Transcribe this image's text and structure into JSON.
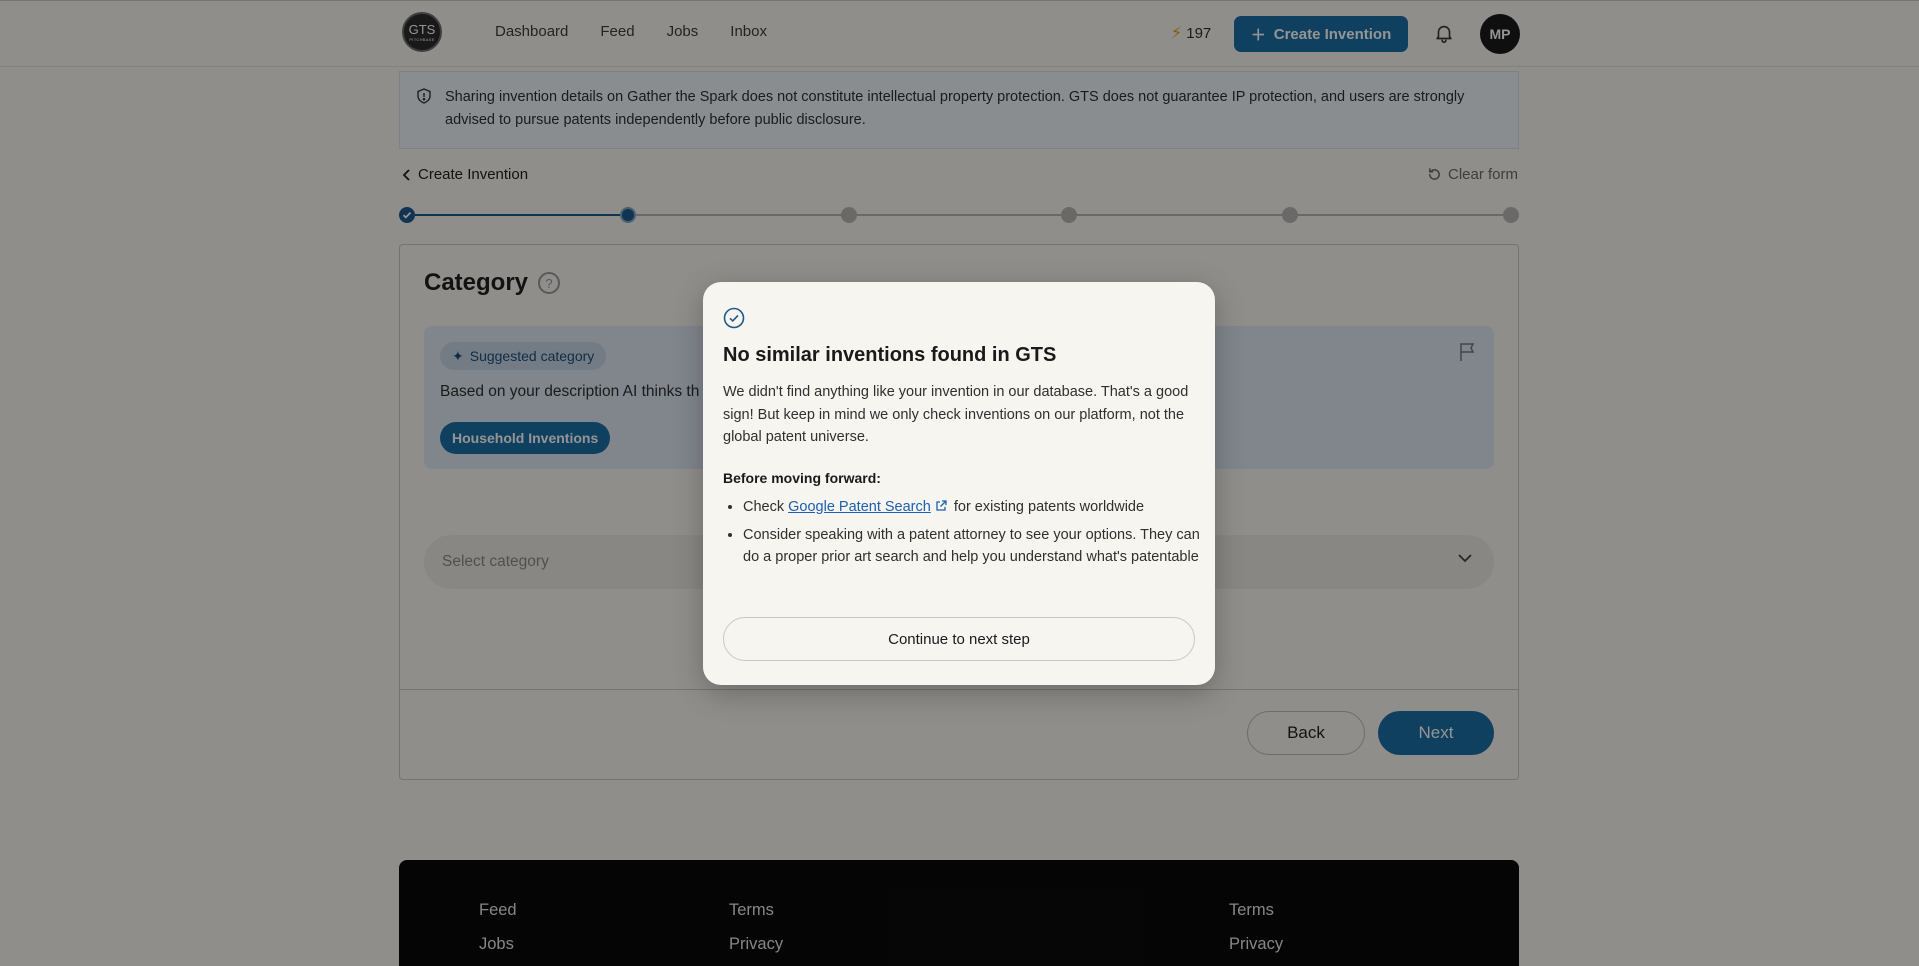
{
  "header": {
    "logo_text": "GTS",
    "logo_subtext": "PITCHBASE",
    "nav": [
      "Dashboard",
      "Feed",
      "Jobs",
      "Inbox"
    ],
    "credits": "197",
    "create_button": "Create Invention",
    "avatar_initials": "MP"
  },
  "notice": {
    "text": "Sharing invention details on Gather the Spark does not constitute intellectual property protection. GTS does not guarantee IP protection, and users are strongly advised to pursue patents independently before public disclosure."
  },
  "page": {
    "back_label": "Create Invention",
    "clear_form": "Clear form",
    "stepper": {
      "total_steps": 6,
      "completed": 1,
      "current": 2
    }
  },
  "card": {
    "title": "Category",
    "suggest_chip": "Suggested category",
    "suggest_text": "Based on your description AI thinks th",
    "suggested_value": "Household Inventions",
    "select_placeholder": "Select category",
    "back_button": "Back",
    "next_button": "Next"
  },
  "footer": {
    "col1": [
      "Feed",
      "Jobs"
    ],
    "col2": [
      "Terms",
      "Privacy"
    ],
    "col3": [
      "Terms",
      "Privacy"
    ]
  },
  "modal": {
    "title": "No similar inventions found in GTS",
    "description": "We didn't find anything like your invention in our database. That's a good sign! But keep in mind we only check inventions on our platform, not the global patent universe.",
    "before_heading": "Before moving forward:",
    "bullet1_prefix": "Check",
    "bullet1_link": "Google Patent Search",
    "bullet1_suffix": "for existing patents worldwide",
    "bullet2": "Consider speaking with a patent attorney to see your options. They can do a proper prior art search and help you understand what's patentable",
    "continue_button": "Continue to next step"
  },
  "colors": {
    "accent": "#1c6ea4",
    "link": "#1c5fb0",
    "bolt": "#e0a100"
  }
}
